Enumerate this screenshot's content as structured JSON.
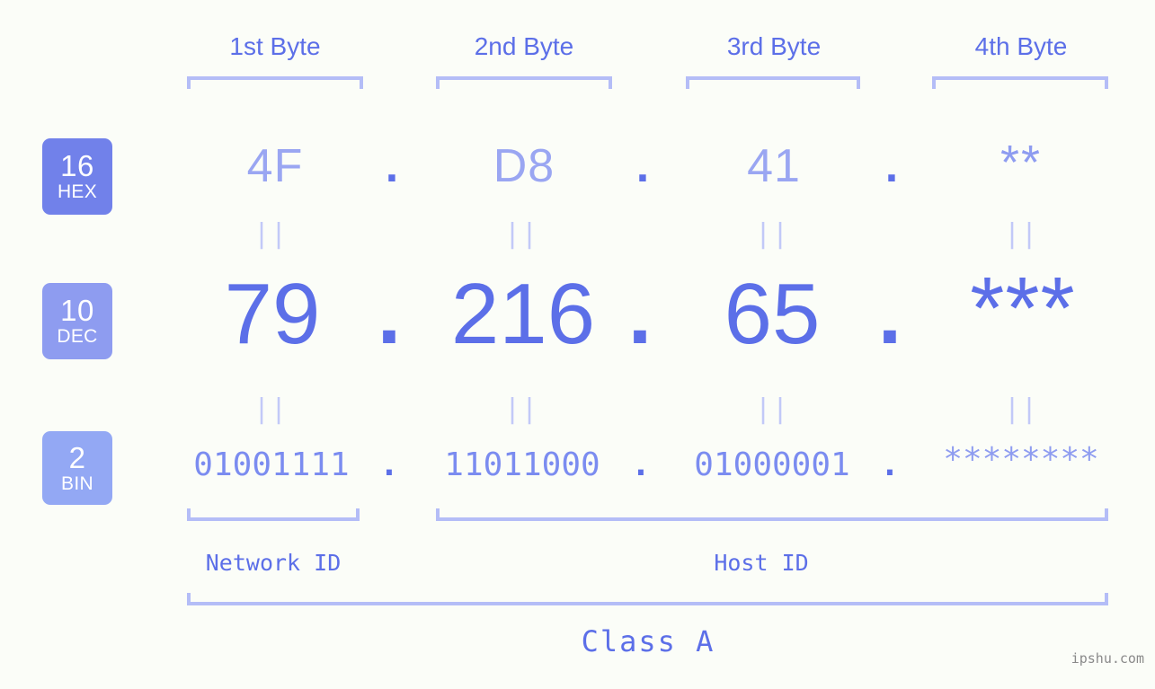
{
  "background_color": "#fbfdf8",
  "accent_colors": {
    "primary": "#5c6fe8",
    "light": "#9aa6f2",
    "bracket": "#b4bdf7",
    "badge_hex": "#7181ea",
    "badge_dec": "#8e9cf0",
    "badge_bin": "#93a8f4",
    "watermark": "#8a8a8a"
  },
  "byte_headers": [
    {
      "label": "1st Byte"
    },
    {
      "label": "2nd Byte"
    },
    {
      "label": "3rd Byte"
    },
    {
      "label": "4th Byte"
    }
  ],
  "bases": [
    {
      "number": "16",
      "name": "HEX"
    },
    {
      "number": "10",
      "name": "DEC"
    },
    {
      "number": "2",
      "name": "BIN"
    }
  ],
  "rows": {
    "hex": {
      "base_number": "16",
      "base_name": "HEX",
      "values": [
        "4F",
        "D8",
        "41",
        "**"
      ]
    },
    "dec": {
      "base_number": "10",
      "base_name": "DEC",
      "values": [
        "79",
        "216",
        "65",
        "***"
      ]
    },
    "bin": {
      "base_number": "2",
      "base_name": "BIN",
      "values": [
        "01001111",
        "11011000",
        "01000001",
        "********"
      ]
    }
  },
  "separator": ".",
  "equals_marker": "||",
  "segments": [
    {
      "label": "Network ID"
    },
    {
      "label": "Host ID"
    }
  ],
  "class_label": "Class A",
  "watermark": "ipshu.com"
}
